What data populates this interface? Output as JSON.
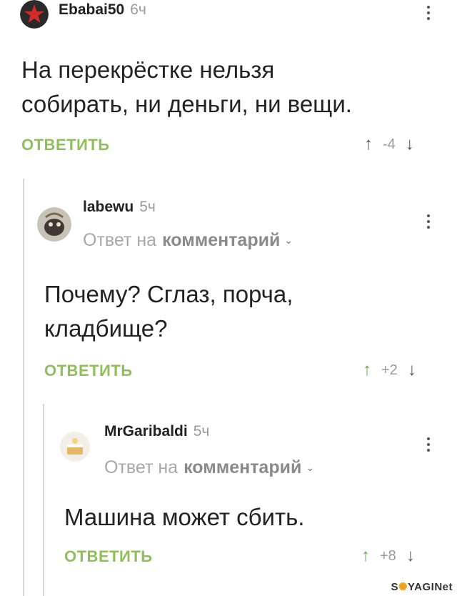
{
  "comments": [
    {
      "username": "Ebabai50",
      "time": "6ч",
      "text_line1": "На перекрёстке нельзя",
      "text_line2": "собирать, ни деньги, ни вещи.",
      "reply_label": "ОТВЕТИТЬ",
      "rating": "-4"
    },
    {
      "username": "labewu",
      "time": "5ч",
      "reply_to_prefix": "Ответ на",
      "reply_to_target": "комментарий",
      "text_line1": "Почему? Сглаз, порча,",
      "text_line2": "кладбище?",
      "reply_label": "ОТВЕТИТЬ",
      "rating": "+2"
    },
    {
      "username": "MrGaribaldi",
      "time": "5ч",
      "reply_to_prefix": "Ответ на",
      "reply_to_target": "комментарий",
      "text_line1": "Машина может сбить.",
      "reply_label": "ОТВЕТИТЬ",
      "rating": "+8"
    }
  ],
  "icons": {
    "up": "↑",
    "down": "↓",
    "chevron": "⌄"
  },
  "colors": {
    "reply_green": "#8fbf5a",
    "thread_line": "#d8d8d8"
  },
  "watermark": {
    "prefix": "S",
    "mid": "✺",
    "suffix": "YAGINet"
  }
}
